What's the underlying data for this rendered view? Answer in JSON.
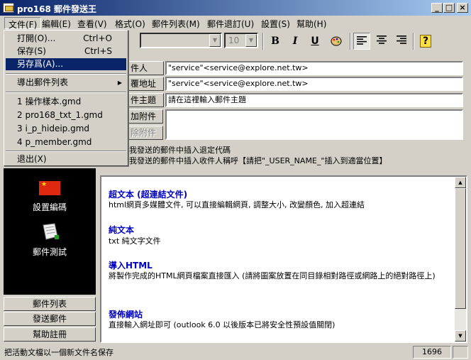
{
  "window": {
    "title": "pro168 郵件發送王",
    "minimize": "_",
    "maximize": "□",
    "close": "×"
  },
  "menubar": [
    {
      "label": "文件(F)"
    },
    {
      "label": "編輯(E)"
    },
    {
      "label": "查看(V)"
    },
    {
      "label": "格式(O)"
    },
    {
      "label": "郵件列表(M)"
    },
    {
      "label": "郵件退訂(U)"
    },
    {
      "label": "設置(S)"
    },
    {
      "label": "幫助(H)"
    }
  ],
  "file_menu": {
    "open": {
      "label": "打開(O)...",
      "shortcut": "Ctrl+O"
    },
    "save": {
      "label": "保存(S)",
      "shortcut": "Ctrl+S"
    },
    "save_as": {
      "label": "另存爲(A)..."
    },
    "export": {
      "label": "導出郵件列表"
    },
    "recent": [
      "1 操作樣本.gmd",
      "2 pro168_txt_1.gmd",
      "3 i_p_hideip.gmd",
      "4 p_member.gmd"
    ],
    "exit": {
      "label": "退出(X)"
    }
  },
  "toolbar": {
    "font_size": "10",
    "bold": "B",
    "italic": "I",
    "underline": "U"
  },
  "form": {
    "sender_label": "件人",
    "sender_value": "\"service\"<service@explore.net.tw>",
    "reply_label": "覆地址",
    "reply_value": "\"service\"<service@explore.net.tw>",
    "subject_label": "件主題",
    "subject_value": "請在這裡輸入郵件主題",
    "add_attach": "加附件",
    "del_attach": "除附件",
    "option1": "我發送的郵件中插入退定代碼",
    "option2": "我發送的郵件中插入收件人稱呼【請把\"_USER_NAME_\"插入到適當位置】"
  },
  "sidebar": {
    "settings_label": "設置編碼",
    "test_label": "郵件測試",
    "buttons": [
      "郵件列表",
      "發送郵件",
      "幫助註冊"
    ]
  },
  "content": {
    "items": [
      {
        "title": "超文本 (超連結文件)",
        "desc": "html網頁多媒體文件, 可以直接編輯網頁, 調整大小, 改變顏色, 加入超連結"
      },
      {
        "title": "純文本",
        "desc": "txt 純文字文件"
      },
      {
        "title": "導入HTML",
        "desc": "將製作完成的HTML網頁檔案直接匯入 (請將圖案放置在同目錄相對路徑或網路上的絕對路徑上)"
      },
      {
        "title": "發佈網站",
        "desc": "直接輸入網址即可 (outlook 6.0 以後版本已將安全性預設值關閉)"
      }
    ]
  },
  "status": {
    "text": "把活動文檔以一個新文件名保存",
    "count": "1696"
  }
}
